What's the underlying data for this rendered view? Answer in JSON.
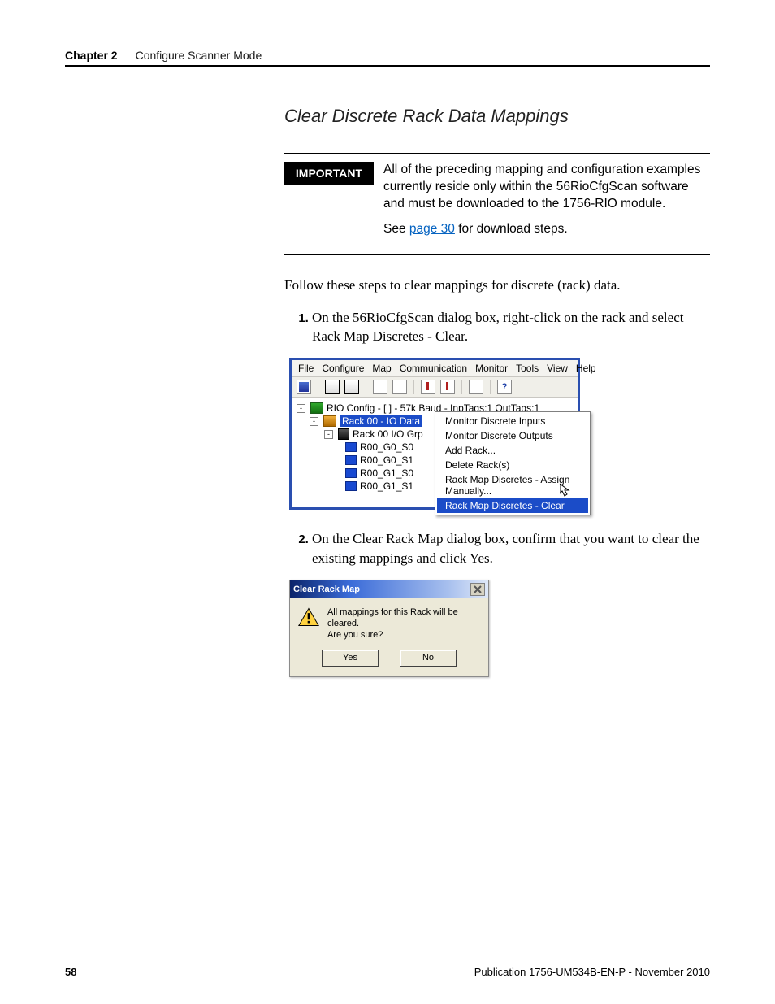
{
  "header": {
    "chapter": "Chapter 2",
    "title": "Configure Scanner Mode"
  },
  "section_title": "Clear Discrete Rack Data Mappings",
  "important": {
    "label": "IMPORTANT",
    "text": "All of the preceding mapping and configuration examples currently reside only within the 56RioCfgScan software and must be downloaded to the 1756-RIO module.",
    "see_prefix": "See ",
    "see_link": "page 30",
    "see_suffix": " for download steps."
  },
  "intro": "Follow these steps to clear mappings for discrete (rack) data.",
  "steps": {
    "s1": "On the 56RioCfgScan dialog box, right-click on the rack and select Rack Map Discretes - Clear.",
    "s2": "On the Clear Rack Map dialog box, confirm that you want to clear the existing mappings and click Yes."
  },
  "screenshot1": {
    "menubar": [
      "File",
      "Configure",
      "Map",
      "Communication",
      "Monitor",
      "Tools",
      "View",
      "Help"
    ],
    "tree": {
      "root": "RIO Config - [ ] - 57k Baud - InpTags:1 OutTags:1",
      "rack": "Rack 00 - IO Data",
      "group": "Rack 00 I/O Grp",
      "slots": [
        "R00_G0_S0",
        "R00_G0_S1",
        "R00_G1_S0",
        "R00_G1_S1"
      ]
    },
    "context_menu": {
      "items": [
        "Monitor Discrete Inputs",
        "Monitor Discrete Outputs",
        "Add Rack...",
        "Delete Rack(s)",
        "Rack Map Discretes - Assign Manually...",
        "Rack Map Discretes - Clear"
      ],
      "selected_index": 5
    }
  },
  "screenshot2": {
    "title": "Clear Rack Map",
    "message_line1": "All mappings for this Rack will be cleared.",
    "message_line2": "Are you sure?",
    "yes": "Yes",
    "no": "No"
  },
  "footer": {
    "page": "58",
    "pub": "Publication 1756-UM534B-EN-P - November 2010"
  }
}
